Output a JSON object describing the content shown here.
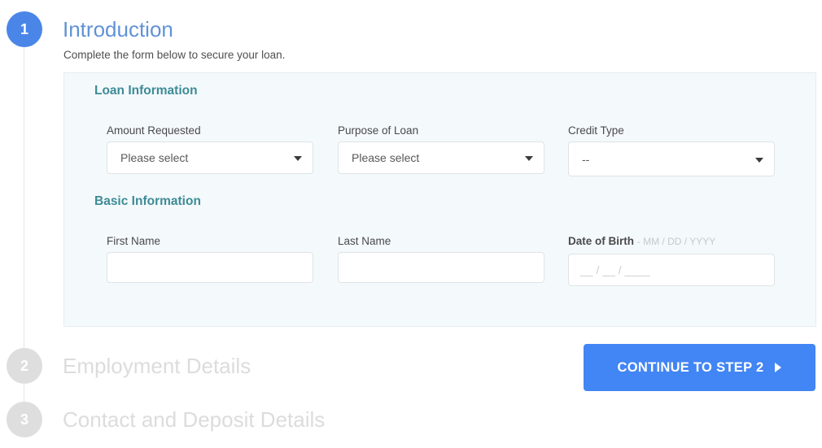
{
  "steps": [
    {
      "number": "1",
      "title": "Introduction",
      "subtitle": "Complete the form below to secure your loan.",
      "state": "active"
    },
    {
      "number": "2",
      "title": "Employment Details",
      "state": "inactive"
    },
    {
      "number": "3",
      "title": "Contact and Deposit Details",
      "state": "inactive"
    }
  ],
  "panel": {
    "sections": {
      "loan": "Loan Information",
      "basic": "Basic Information"
    },
    "fields": {
      "amount_requested": {
        "label": "Amount Requested",
        "value": "Please select",
        "options": [
          "Please select"
        ]
      },
      "purpose_of_loan": {
        "label": "Purpose of Loan",
        "value": "Please select",
        "options": [
          "Please select"
        ]
      },
      "credit_type": {
        "label": "Credit Type",
        "value": "--",
        "options": [
          "--"
        ]
      },
      "first_name": {
        "label": "First Name",
        "value": "",
        "placeholder": ""
      },
      "last_name": {
        "label": "Last Name",
        "value": "",
        "placeholder": ""
      },
      "date_of_birth": {
        "label": "Date of Birth",
        "label_hint": "- MM / DD / YYYY",
        "value": "",
        "placeholder": "__ / __ / ____"
      }
    }
  },
  "cta": {
    "label": "Continue to Step 2",
    "arrow_icon": "chevron-right-icon"
  },
  "colors": {
    "accent_blue": "#4285f4",
    "step_active_title": "#6192d6",
    "step_inactive": "#dcdcdc",
    "section_heading": "#3d8b96",
    "panel_bg": "#f4f9fc",
    "panel_border": "#e3edf3",
    "input_border": "#dfe3e6"
  }
}
